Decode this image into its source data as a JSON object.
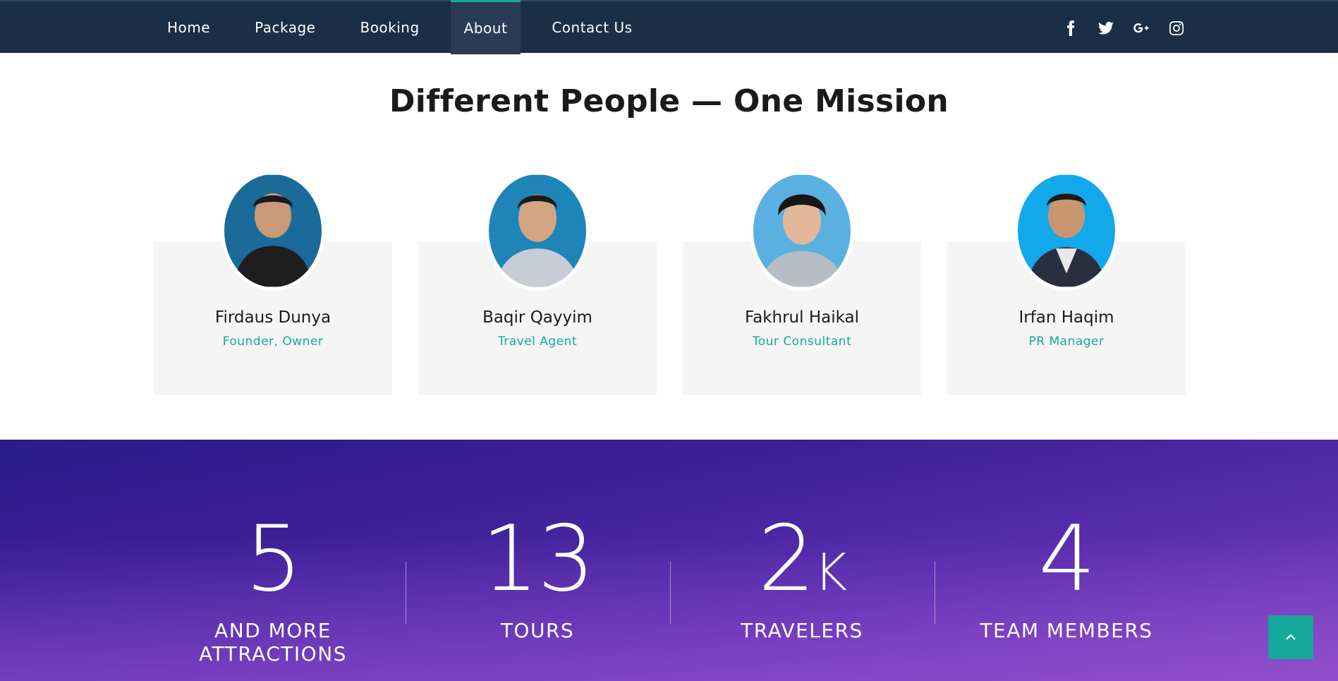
{
  "nav": {
    "items": [
      {
        "label": "Home"
      },
      {
        "label": "Package"
      },
      {
        "label": "Booking"
      },
      {
        "label": "About"
      },
      {
        "label": "Contact Us"
      }
    ],
    "active": "About",
    "socials": [
      "facebook-icon",
      "twitter-icon",
      "google-plus-icon",
      "instagram-icon"
    ]
  },
  "team": {
    "title": "Different People — One Mission",
    "members": [
      {
        "name": "Firdaus Dunya",
        "role": "Founder, Owner",
        "avatar_bg": "#1a6a9a"
      },
      {
        "name": "Baqir Qayyim",
        "role": "Travel Agent",
        "avatar_bg": "#1f84b8"
      },
      {
        "name": "Fakhrul Haikal",
        "role": "Tour Consultant",
        "avatar_bg": "#5ab0e0"
      },
      {
        "name": "Irfan Haqim",
        "role": "PR Manager",
        "avatar_bg": "#12a8ea"
      }
    ]
  },
  "stats": [
    {
      "number": "5",
      "suffix": "",
      "label_line1": "AND MORE",
      "label_line2": "ATTRACTIONS"
    },
    {
      "number": "13",
      "suffix": "",
      "label_line1": "TOURS",
      "label_line2": ""
    },
    {
      "number": "2",
      "suffix": "K",
      "label_line1": "TRAVELERS",
      "label_line2": ""
    },
    {
      "number": "4",
      "suffix": "",
      "label_line1": "TEAM MEMBERS",
      "label_line2": ""
    }
  ],
  "colors": {
    "accent": "#16a89c",
    "nav_bg": "#1a2e46"
  },
  "back_to_top_icon": "chevron-up-icon"
}
